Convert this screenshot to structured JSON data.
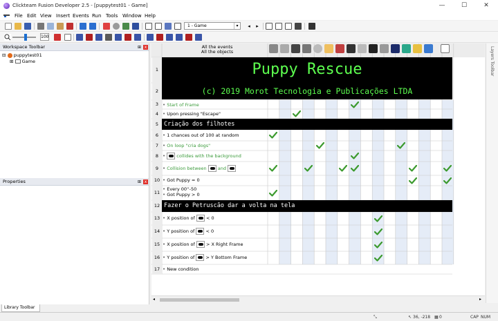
{
  "window": {
    "title": "Clickteam Fusion Developer 2.5 - [puppytest01 - Game]",
    "minimize": "—",
    "maximize": "☐",
    "close": "✕"
  },
  "menu": [
    "File",
    "Edit",
    "View",
    "Insert",
    "Events",
    "Run",
    "Tools",
    "Window",
    "Help"
  ],
  "toolbar": {
    "frame_select": "1 - Game",
    "zoom": "100"
  },
  "workspace": {
    "title": "Workspace Toolbar",
    "app": "puppytest01",
    "frame": "Game"
  },
  "properties": {
    "title": "Properties"
  },
  "library": {
    "tab": "Library Toolbar"
  },
  "right_toolbar": {
    "label": "Layers Toolbar"
  },
  "editor": {
    "all_events": "All the events",
    "all_objects": "All the objects",
    "comments": {
      "title": "Puppy Rescue",
      "copyright": "(c) 2019 Morot Tecnologia e Publicações LTDA",
      "section_children": "Criação dos filhotes",
      "section_wrap": "Fazer o Petruscão dar a volta na tela"
    },
    "rows": [
      {
        "num": "1"
      },
      {
        "num": "2"
      },
      {
        "num": "3",
        "text": "Start of Frame"
      },
      {
        "num": "4",
        "text": "Upon pressing \"Escape\""
      },
      {
        "num": "5"
      },
      {
        "num": "6",
        "text": "1 chances out of 100 at random"
      },
      {
        "num": "7",
        "text": "On loop \"cria dogs\""
      },
      {
        "num": "8",
        "text": "collides with the background"
      },
      {
        "num": "9",
        "text_a": "Collision between",
        "text_b": "and"
      },
      {
        "num": "10",
        "text": "Got Puppy = 0"
      },
      {
        "num": "11",
        "text": "Every 00''-50",
        "text2": "Got Puppy > 0"
      },
      {
        "num": "12"
      },
      {
        "num": "13",
        "text_a": "X position of",
        "text_b": "< 0"
      },
      {
        "num": "14",
        "text_a": "Y position of",
        "text_b": "< 0"
      },
      {
        "num": "15",
        "text_a": "X position of",
        "text_b": "> X Right Frame"
      },
      {
        "num": "16",
        "text_a": "Y position of",
        "text_b": "> Y Bottom Frame"
      },
      {
        "num": "17",
        "text": "New condition"
      }
    ],
    "action_ticks": [
      [
        3,
        7
      ],
      [
        4,
        2
      ],
      [
        6,
        0
      ],
      [
        7,
        4
      ],
      [
        7,
        11
      ],
      [
        8,
        7
      ],
      [
        9,
        0
      ],
      [
        9,
        3
      ],
      [
        9,
        6
      ],
      [
        9,
        7
      ],
      [
        9,
        12
      ],
      [
        9,
        15
      ],
      [
        10,
        12
      ],
      [
        10,
        15
      ],
      [
        11,
        0
      ],
      [
        13,
        9
      ],
      [
        14,
        9
      ],
      [
        15,
        9
      ],
      [
        16,
        9
      ]
    ]
  },
  "status": {
    "coords": "36, -218",
    "zero": "0",
    "caps": "CAP",
    "num": "NUM"
  }
}
